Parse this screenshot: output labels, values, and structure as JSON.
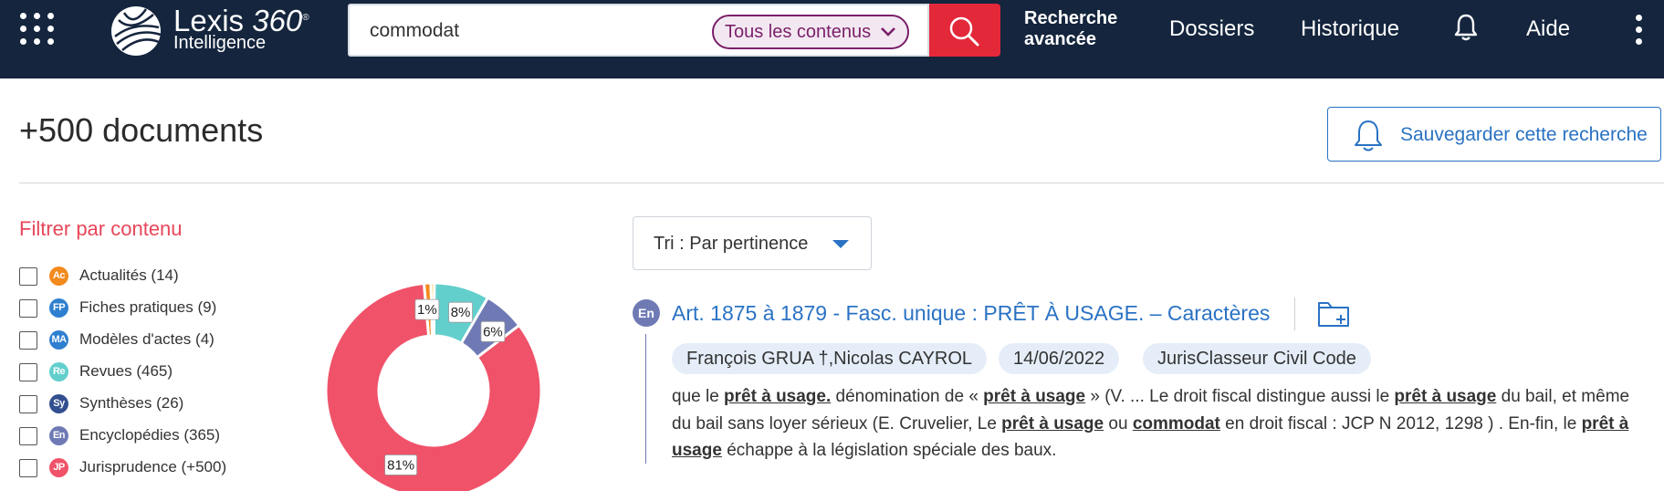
{
  "header": {
    "logo": {
      "brand": "Lexis",
      "version": "360",
      "reg_mark": "®",
      "sub": "Intelligence"
    },
    "search": {
      "value": "commodat",
      "placeholder": ""
    },
    "scope": {
      "label": "Tous les contenus"
    },
    "nav": {
      "advanced_line1": "Recherche",
      "advanced_line2": "avancée",
      "folders": "Dossiers",
      "history": "Historique",
      "help": "Aide"
    },
    "icons": [
      "apps-grid-icon",
      "search-icon",
      "bell-icon",
      "kebab-menu-icon"
    ]
  },
  "results": {
    "count_label": "+500 documents",
    "save_search_label": "Sauvegarder cette recherche"
  },
  "filters": {
    "title": "Filtrer par contenu",
    "items": [
      {
        "abbr": "Ac",
        "label": "Actualités (14)",
        "color": "#f28a1e"
      },
      {
        "abbr": "FP",
        "label": "Fiches pratiques (9)",
        "color": "#2f7fd0"
      },
      {
        "abbr": "MA",
        "label": "Modèles d'actes (4)",
        "color": "#2f7fd0"
      },
      {
        "abbr": "Re",
        "label": "Revues (465)",
        "color": "#62cfcd"
      },
      {
        "abbr": "Sy",
        "label": "Synthèses (26)",
        "color": "#324f8f"
      },
      {
        "abbr": "En",
        "label": "Encyclopédies (365)",
        "color": "#6f7ab5"
      },
      {
        "abbr": "JP",
        "label": "Jurisprudence (+500)",
        "color": "#f0526a"
      }
    ]
  },
  "chart_data": {
    "type": "pie",
    "style": "donut",
    "slices": [
      {
        "label": "1%",
        "value": 1,
        "color": "#f28a1e"
      },
      {
        "label": "",
        "value": 0.5,
        "color": "#f5b731"
      },
      {
        "label": "8%",
        "value": 8,
        "color": "#62cfcd"
      },
      {
        "label": "6%",
        "value": 6,
        "color": "#6f7ab5"
      },
      {
        "label": "81%",
        "value": 81,
        "color": "#f0526a"
      }
    ]
  },
  "sort": {
    "label": "Tri : Par pertinence"
  },
  "result": {
    "badge": "En",
    "title": "Art. 1875 à 1879 - Fasc. unique : PRÊT À USAGE. – Caractères",
    "tags": [
      "François GRUA †,Nicolas CAYROL",
      "14/06/2022",
      "JurisClasseur Civil Code"
    ],
    "snippet": [
      {
        "t": "que le ",
        "b": false
      },
      {
        "t": "prêt à usage.",
        "b": true
      },
      {
        "t": " dénomination de « ",
        "b": false
      },
      {
        "t": "prêt à usage",
        "b": true
      },
      {
        "t": " » (V. ... Le droit fiscal distingue aussi le ",
        "b": false
      },
      {
        "t": "prêt à usage",
        "b": true
      },
      {
        "t": " du bail, et même du bail sans loyer sérieux (E. Cruvelier, Le ",
        "b": false
      },
      {
        "t": "prêt à usage",
        "b": true
      },
      {
        "t": " ou ",
        "b": false
      },
      {
        "t": "commodat",
        "b": true
      },
      {
        "t": " en droit fiscal : JCP N 2012, 1298 ) . En-fin, le ",
        "b": false
      },
      {
        "t": "prêt à usage",
        "b": true
      },
      {
        "t": " échappe à la législation spéciale des baux.",
        "b": false
      }
    ]
  }
}
